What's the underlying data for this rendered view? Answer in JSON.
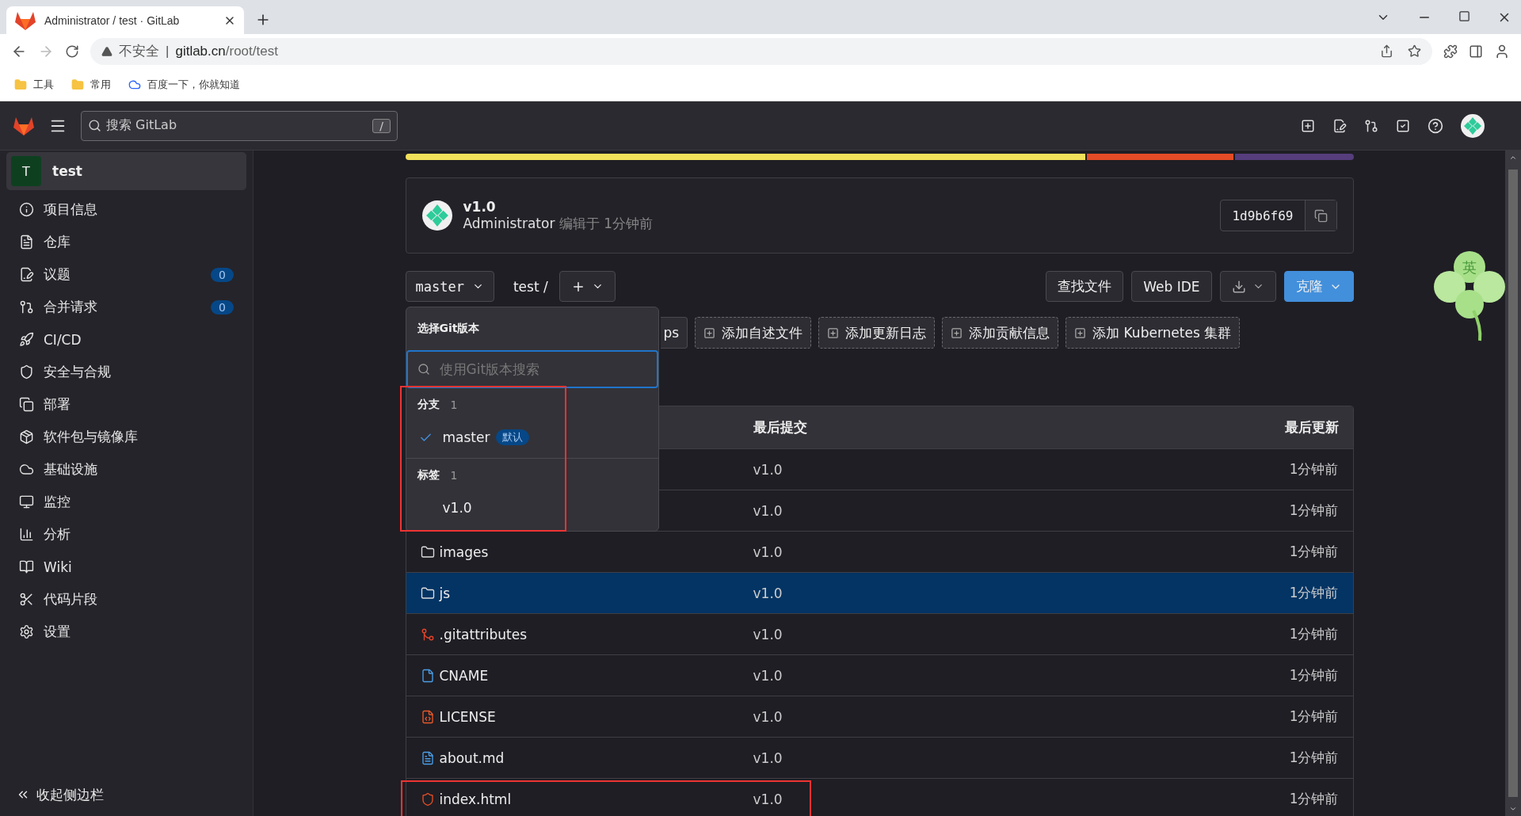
{
  "browser": {
    "tab_title": "Administrator / test · GitLab",
    "security": "不安全",
    "security_separator": "|",
    "url_host": "gitlab.cn",
    "url_path": "/root/test",
    "bookmarks": [
      {
        "label": "工具",
        "kind": "folder"
      },
      {
        "label": "常用",
        "kind": "folder"
      },
      {
        "label": "百度一下，你就知道",
        "kind": "site"
      }
    ]
  },
  "header": {
    "search_placeholder": "搜索 GitLab",
    "search_key": "/"
  },
  "sidebar": {
    "project": {
      "initial": "T",
      "name": "test"
    },
    "items": [
      {
        "label": "项目信息",
        "kind": "info"
      },
      {
        "label": "仓库",
        "kind": "file"
      },
      {
        "label": "议题",
        "kind": "issues",
        "count": "0"
      },
      {
        "label": "合并请求",
        "kind": "merge",
        "count": "0"
      },
      {
        "label": "CI/CD",
        "kind": "rocket"
      },
      {
        "label": "安全与合规",
        "kind": "shield"
      },
      {
        "label": "部署",
        "kind": "deploy"
      },
      {
        "label": "软件包与镜像库",
        "kind": "package"
      },
      {
        "label": "基础设施",
        "kind": "cloud"
      },
      {
        "label": "监控",
        "kind": "monitor"
      },
      {
        "label": "分析",
        "kind": "chart"
      },
      {
        "label": "Wiki",
        "kind": "book"
      },
      {
        "label": "代码片段",
        "kind": "scissors"
      },
      {
        "label": "设置",
        "kind": "gear"
      }
    ],
    "collapse": "收起侧边栏"
  },
  "language_bar": [
    {
      "color": "#f1e05a"
    },
    {
      "color": "#e34c26"
    },
    {
      "color": "#563d7c"
    }
  ],
  "commit": {
    "title": "v1.0",
    "author": "Administrator",
    "meta": "编辑于 1分钟前",
    "sha": "1d9b6f69"
  },
  "ref_bar": {
    "ref": "master",
    "path": "test",
    "separator": "/"
  },
  "actions": [
    {
      "kind": "text",
      "label": "查找文件"
    },
    {
      "kind": "text",
      "label": "Web IDE"
    },
    {
      "kind": "download"
    },
    {
      "kind": "primary",
      "label": "克隆"
    }
  ],
  "suggestions": [
    {
      "kind": "partial",
      "label": "ps"
    },
    {
      "kind": "add",
      "label": "添加自述文件"
    },
    {
      "kind": "add",
      "label": "添加更新日志"
    },
    {
      "kind": "add",
      "label": "添加贡献信息"
    },
    {
      "kind": "add",
      "label": "添加 Kubernetes 集群"
    }
  ],
  "dropdown": {
    "title": "选择Git版本",
    "search_placeholder": "使用Git版本搜索",
    "highlighted": true,
    "sections": [
      {
        "heading": "分支",
        "count": "1",
        "items": [
          {
            "label": "master",
            "badge": "默认",
            "selected": true
          }
        ]
      },
      {
        "heading": "标签",
        "count": "1",
        "items": [
          {
            "label": "v1.0",
            "selected": false
          }
        ]
      }
    ]
  },
  "table": {
    "columns": [
      "最后提交",
      "最后更新"
    ],
    "rows": [
      {
        "commit": "v1.0",
        "updated": "1分钟前",
        "selected": false,
        "highlighted": false
      },
      {
        "commit": "v1.0",
        "updated": "1分钟前",
        "selected": false,
        "highlighted": false
      },
      {
        "name": "images",
        "kind": "folder",
        "commit": "v1.0",
        "updated": "1分钟前",
        "selected": false,
        "highlighted": false
      },
      {
        "name": "js",
        "kind": "folder",
        "commit": "v1.0",
        "updated": "1分钟前",
        "selected": true,
        "highlighted": false
      },
      {
        "name": ".gitattributes",
        "kind": "git",
        "commit": "v1.0",
        "updated": "1分钟前",
        "selected": false,
        "highlighted": false
      },
      {
        "name": "CNAME",
        "kind": "file",
        "commit": "v1.0",
        "updated": "1分钟前",
        "selected": false,
        "highlighted": false
      },
      {
        "name": "LICENSE",
        "kind": "license",
        "commit": "v1.0",
        "updated": "1分钟前",
        "selected": false,
        "highlighted": false
      },
      {
        "name": "about.md",
        "kind": "markdown",
        "commit": "v1.0",
        "updated": "1分钟前",
        "selected": false,
        "highlighted": false
      },
      {
        "name": "index.html",
        "kind": "html",
        "commit": "v1.0",
        "updated": "1分钟前",
        "selected": false,
        "highlighted": true
      }
    ]
  },
  "ime_widget": {
    "label": "英"
  }
}
